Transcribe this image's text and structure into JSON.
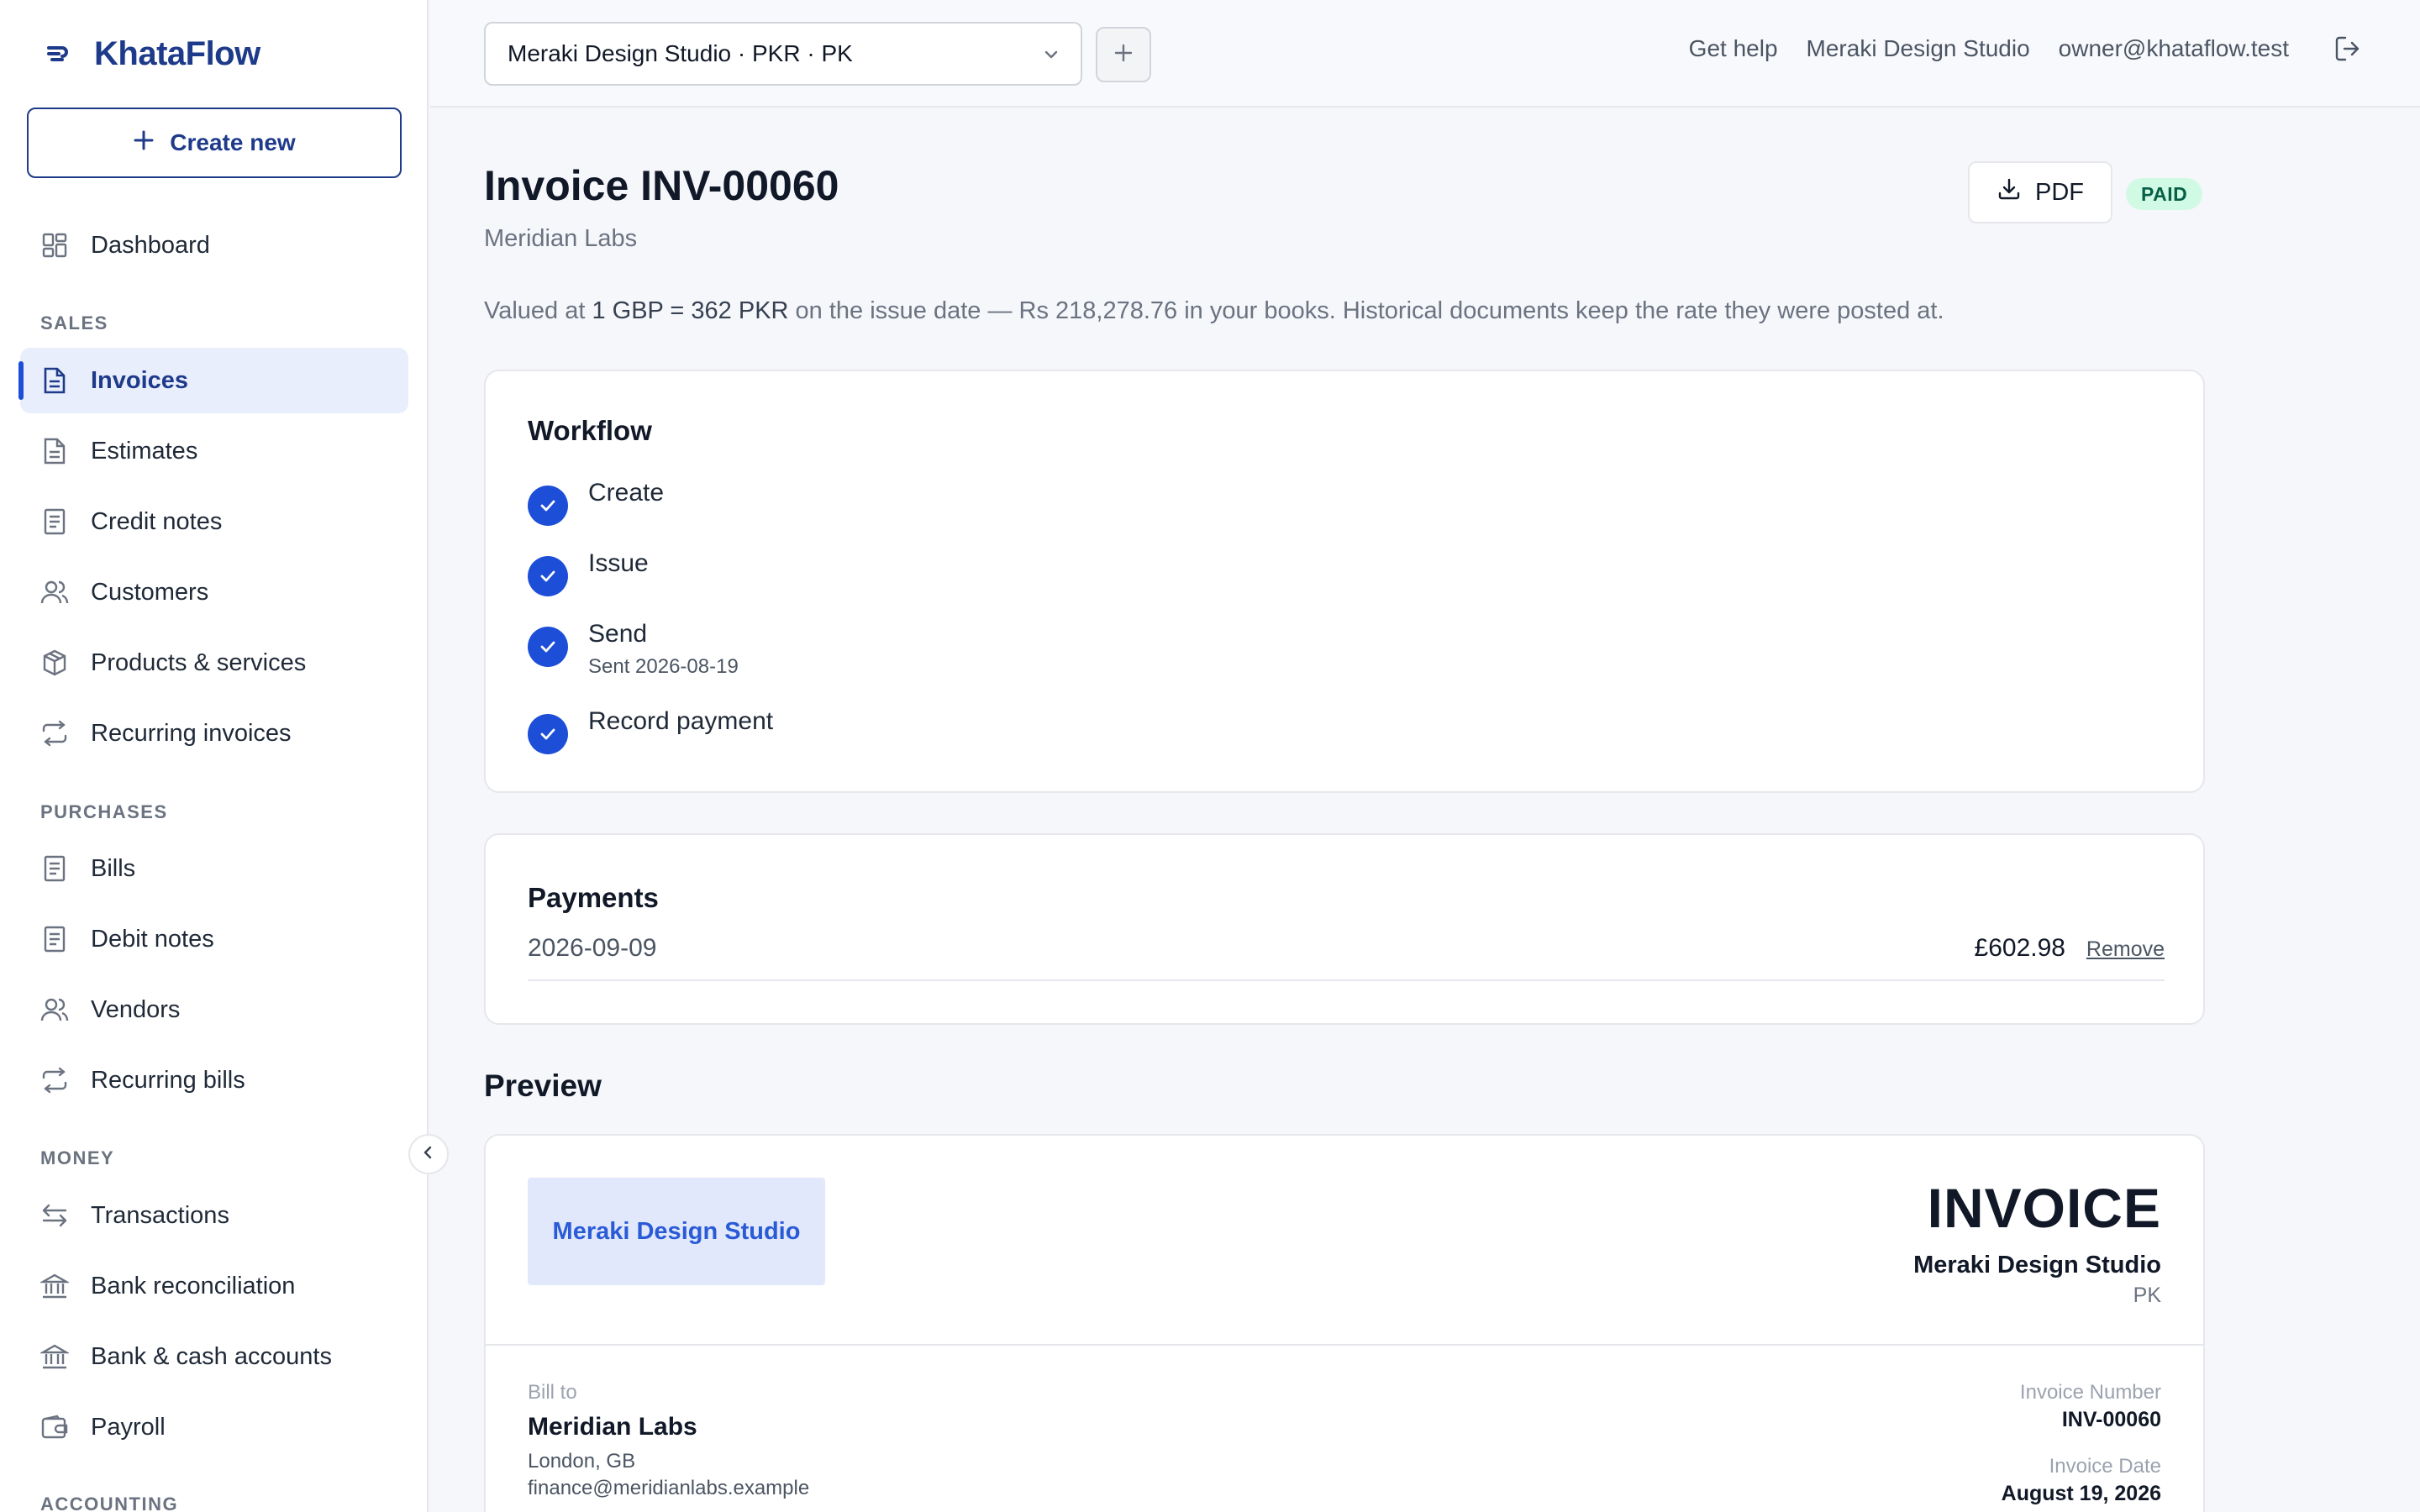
{
  "brand": {
    "name": "KhataFlow"
  },
  "sidebar": {
    "create_label": "Create new",
    "dashboard": "Dashboard",
    "sections": {
      "sales": "SALES",
      "purchases": "PURCHASES",
      "money": "MONEY",
      "accounting": "ACCOUNTING"
    },
    "sales_items": [
      "Invoices",
      "Estimates",
      "Credit notes",
      "Customers",
      "Products & services",
      "Recurring invoices"
    ],
    "purchase_items": [
      "Bills",
      "Debit notes",
      "Vendors",
      "Recurring bills"
    ],
    "money_items": [
      "Transactions",
      "Bank reconciliation",
      "Bank & cash accounts",
      "Payroll"
    ],
    "active_item": "Invoices"
  },
  "topbar": {
    "org_selector": "Meraki Design Studio · PKR · PK",
    "help": "Get help",
    "org_name": "Meraki Design Studio",
    "user_email": "owner@khataflow.test"
  },
  "invoice": {
    "title": "Invoice INV-00060",
    "customer": "Meridian Labs",
    "pdf_label": "PDF",
    "status": "PAID",
    "rate_prefix": "Valued at ",
    "rate_value": "1 GBP = 362 PKR",
    "rate_suffix": " on the issue date — Rs 218,278.76 in your books. Historical documents keep the rate they were posted at."
  },
  "workflow": {
    "title": "Workflow",
    "steps": [
      {
        "label": "Create",
        "sub": ""
      },
      {
        "label": "Issue",
        "sub": ""
      },
      {
        "label": "Send",
        "sub": "Sent 2026-08-19"
      },
      {
        "label": "Record payment",
        "sub": ""
      }
    ]
  },
  "payments": {
    "title": "Payments",
    "rows": [
      {
        "date": "2026-09-09",
        "amount": "£602.98",
        "action": "Remove"
      }
    ]
  },
  "preview": {
    "title": "Preview",
    "logo_text": "Meraki Design Studio",
    "heading": "INVOICE",
    "from_name": "Meraki Design Studio",
    "from_country": "PK",
    "bill_to_label": "Bill to",
    "bill_to_name": "Meridian Labs",
    "bill_to_location": "London, GB",
    "bill_to_email": "finance@meridianlabs.example",
    "number_label": "Invoice Number",
    "number_value": "INV-00060",
    "date_label": "Invoice Date",
    "date_value": "August 19, 2026"
  },
  "colors": {
    "brand": "#1e3a8a",
    "accent": "#1d4ed8",
    "active_bg": "#e8eefc",
    "paid_bg": "#d1fae5",
    "paid_text": "#065f46"
  }
}
